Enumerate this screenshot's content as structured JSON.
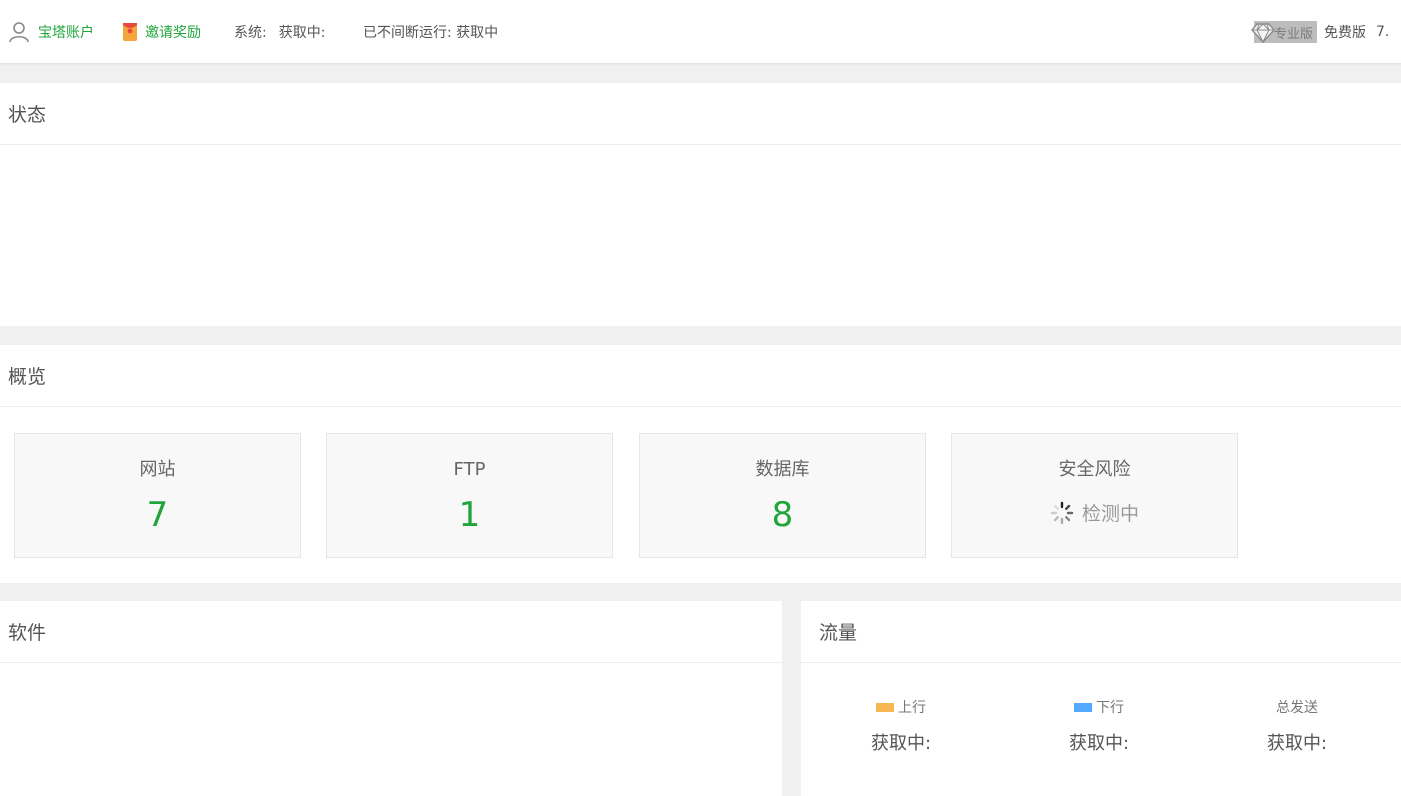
{
  "header": {
    "account_label": "宝塔账户",
    "invite_label": "邀请奖励",
    "system_label": "系统:",
    "system_value": "获取中:",
    "uptime_label": "已不间断运行: 获取中",
    "pro_label": "专业版",
    "free_label": "免费版",
    "version": "7."
  },
  "status": {
    "title": "状态"
  },
  "overview": {
    "title": "概览",
    "cards": [
      {
        "label": "网站",
        "value": "7"
      },
      {
        "label": "FTP",
        "value": "1"
      },
      {
        "label": "数据库",
        "value": "8"
      },
      {
        "label": "安全风险",
        "status": "检测中"
      }
    ]
  },
  "software": {
    "title": "软件"
  },
  "traffic": {
    "title": "流量",
    "columns": [
      {
        "label": "上行",
        "value": "获取中:",
        "color": "#f7b851"
      },
      {
        "label": "下行",
        "value": "获取中:",
        "color": "#52a9ff"
      },
      {
        "label": "总发送",
        "value": "获取中:"
      }
    ]
  },
  "colors": {
    "accent": "#20a53a"
  }
}
